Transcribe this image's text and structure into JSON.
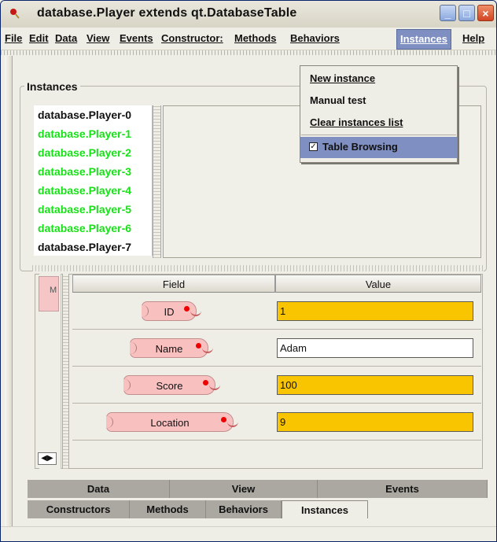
{
  "window": {
    "title": "database.Player extends qt.DatabaseTable",
    "icon": "bean-icon",
    "controls": [
      "minimize-icon",
      "maximize-icon",
      "close-icon"
    ]
  },
  "menu": {
    "items": [
      "File",
      "Edit",
      "Data",
      "View",
      "Events",
      "Constructor:",
      "Methods",
      "Behaviors",
      "Instances",
      "Help"
    ],
    "dropdown": {
      "new_instance": "New instance",
      "manual_test": "Manual test",
      "clear_instances": "Clear instances list",
      "table_browsing": "Table Browsing"
    }
  },
  "instances": {
    "title": "Instances",
    "items": [
      {
        "label": "database.Player-0",
        "color": "#111111"
      },
      {
        "label": "database.Player-1",
        "color": "#18e018"
      },
      {
        "label": "database.Player-2",
        "color": "#18e018"
      },
      {
        "label": "database.Player-3",
        "color": "#18e018"
      },
      {
        "label": "database.Player-4",
        "color": "#18e018"
      },
      {
        "label": "database.Player-5",
        "color": "#18e018"
      },
      {
        "label": "database.Player-6",
        "color": "#18e018"
      },
      {
        "label": "database.Player-7",
        "color": "#111111"
      }
    ]
  },
  "method_tab": {
    "label": "M"
  },
  "table": {
    "headers": {
      "field": "Field",
      "value": "Value"
    },
    "rows": [
      {
        "field": "ID",
        "value": "1",
        "value_style": "yellow"
      },
      {
        "field": "Name",
        "value": "Adam",
        "value_style": "white"
      },
      {
        "field": "Score",
        "value": "100",
        "value_style": "yellow"
      },
      {
        "field": "Location",
        "value": "9",
        "value_style": "yellow"
      }
    ]
  },
  "tabs": {
    "top": [
      "Data",
      "View",
      "Events"
    ],
    "bottom": [
      "Constructors",
      "Methods",
      "Behaviors",
      "Instances"
    ],
    "selected": "Instances"
  },
  "colors": {
    "accent": "#7f8fc2",
    "yellow_value": "#f9c400",
    "pink_field": "#f9c0c0"
  }
}
